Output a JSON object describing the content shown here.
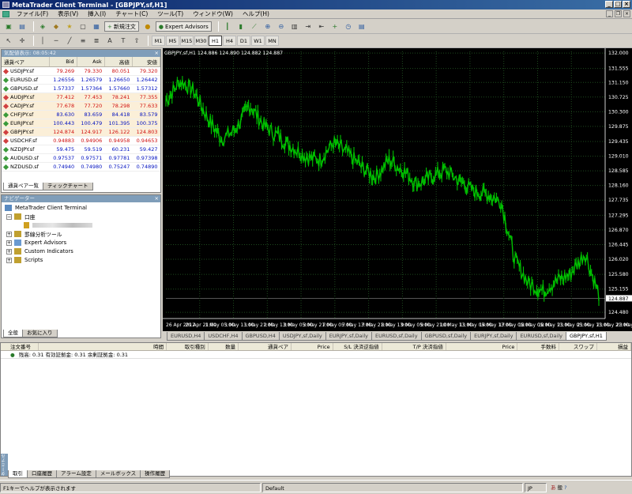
{
  "window": {
    "title": "MetaTrader Client Terminal - [GBPJPY,sf,H1]"
  },
  "menu": [
    "ファイル(F)",
    "表示(V)",
    "挿入(I)",
    "チャート(C)",
    "ツール(T)",
    "ウィンドウ(W)",
    "ヘルプ(H)"
  ],
  "toolbar": {
    "new_order": "新規注文",
    "expert_advisors": "Expert Advisors"
  },
  "timeframes": [
    "M1",
    "M5",
    "M15",
    "M30",
    "H1",
    "H4",
    "D1",
    "W1",
    "MN"
  ],
  "timeframe_active": "H1",
  "market_watch": {
    "title": "気配値表示: 08:05:42",
    "columns": [
      "通貨ペア",
      "Bid",
      "Ask",
      "高値",
      "安値"
    ],
    "rows": [
      {
        "symbol": "USDJPY.sf",
        "bid": "79.269",
        "ask": "79.330",
        "high": "80.051",
        "low": "79.320",
        "dir": "down"
      },
      {
        "symbol": "EURUSD.sf",
        "bid": "1.26556",
        "ask": "1.26579",
        "high": "1.26650",
        "low": "1.26442",
        "dir": "up"
      },
      {
        "symbol": "GBPUSD.sf",
        "bid": "1.57337",
        "ask": "1.57364",
        "high": "1.57660",
        "low": "1.57312",
        "dir": "up"
      },
      {
        "symbol": "AUDJPY.sf",
        "bid": "77.412",
        "ask": "77.453",
        "high": "78.241",
        "low": "77.355",
        "dir": "down"
      },
      {
        "symbol": "CADJPY.sf",
        "bid": "77.678",
        "ask": "77.720",
        "high": "78.298",
        "low": "77.633",
        "dir": "down"
      },
      {
        "symbol": "CHFJPY.sf",
        "bid": "83.630",
        "ask": "83.659",
        "high": "84.418",
        "low": "83.579",
        "dir": "up"
      },
      {
        "symbol": "EURJPY.sf",
        "bid": "100.443",
        "ask": "100.479",
        "high": "101.395",
        "low": "100.375",
        "dir": "up"
      },
      {
        "symbol": "GBPJPY.sf",
        "bid": "124.874",
        "ask": "124.917",
        "high": "126.122",
        "low": "124.803",
        "dir": "down"
      },
      {
        "symbol": "USDCHF.sf",
        "bid": "0.94883",
        "ask": "0.94906",
        "high": "0.94958",
        "low": "0.94653",
        "dir": "down"
      },
      {
        "symbol": "NZDJPY.sf",
        "bid": "59.475",
        "ask": "59.519",
        "high": "60.231",
        "low": "59.427",
        "dir": "up"
      },
      {
        "symbol": "AUDUSD.sf",
        "bid": "0.97537",
        "ask": "0.97571",
        "high": "0.97781",
        "low": "0.97398",
        "dir": "up"
      },
      {
        "symbol": "NZDUSD.sf",
        "bid": "0.74940",
        "ask": "0.74980",
        "high": "0.75247",
        "low": "0.74890",
        "dir": "up"
      }
    ],
    "tabs": [
      "通貨ペア一覧",
      "ティックチャート"
    ]
  },
  "navigator": {
    "title": "ナビゲーター",
    "root": "MetaTrader Client Terminal",
    "account_folder": "口座",
    "items": [
      "罫線分析ツール",
      "Expert Advisors",
      "Custom Indicators",
      "Scripts"
    ],
    "tabs": [
      "全般",
      "お気に入り"
    ]
  },
  "chart": {
    "header": "GBPJPY,sf,H1  124.886 124.890 124.882 124.887",
    "current_price": "124.887",
    "colors": {
      "background": "#000000",
      "candle": "#00c000",
      "grid": "#1e4a1e",
      "axis": "#ffffff"
    }
  },
  "chart_data": {
    "type": "line",
    "title": "GBPJPY,sf,H1",
    "x": [
      "26 Apr 2012",
      "29 Apr 21:00",
      "1 May 05:00",
      "1 May 13:00",
      "1 May 21:00",
      "2 May 05:00",
      "2 May 13:00",
      "3 May 05:00",
      "3 May 21:00",
      "4 May 05:00",
      "4 May 13:00",
      "7 May 05:00",
      "7 May 21:00",
      "8 May 13:00",
      "9 May 05:00",
      "9 May 21:00",
      "10 May 13:00",
      "11 May 05:00",
      "11 May 21:00",
      "14 May 13:00",
      "15 May 05:00",
      "15 May 13:00",
      "15 May 21:00",
      "16 May 13:00",
      "17 May 05:00",
      "17 May 13:00",
      "18 May 05:00",
      "18 May 13:00",
      "21 May 05:00",
      "21 May 21:00",
      "22 May 13:00",
      "23 May 05:00"
    ],
    "series": [
      {
        "values": [
          130.6,
          131.2,
          130.9,
          130.1,
          129.5,
          129.8,
          130.5,
          129.9,
          129.6,
          129.3,
          129.0,
          128.9,
          129.4,
          129.1,
          128.7,
          128.4,
          128.9,
          128.6,
          128.2,
          128.4,
          128.6,
          128.3,
          128.0,
          127.9,
          127.7,
          126.0,
          125.3,
          125.1,
          125.4,
          125.6,
          126.2,
          125.0
        ]
      }
    ],
    "yticks": [
      "132.000",
      "131.555",
      "131.150",
      "130.725",
      "130.300",
      "129.875",
      "129.435",
      "129.010",
      "128.585",
      "128.160",
      "127.735",
      "127.295",
      "126.870",
      "126.445",
      "126.020",
      "125.580",
      "125.155",
      "124.887",
      "124.480"
    ],
    "xticks": [
      "26 Apr 2012",
      "29 Apr 21:00",
      "1 May 05:00",
      "1 May 13:00",
      "1 May 21:00",
      "2 May 13:00",
      "3 May 05:00",
      "3 May 21:00",
      "7 May 05:00",
      "7 May 13:00",
      "7 May 21:00",
      "8 May 13:00",
      "9 May 05:00",
      "9 May 21:00",
      "10 May 13:00",
      "11 May 05:00",
      "14 May 13:00",
      "17 May 05:00",
      "18 May 05:00",
      "18 May 13:00",
      "21 May 05:00",
      "21 May 13:00",
      "21 May 21:00",
      "23 May 08:00"
    ],
    "ylim": [
      124.3,
      132.05
    ]
  },
  "chart_tabs": [
    "EURUSD,H4",
    "USDCHF,H4",
    "GBPUSD,H4",
    "USDJPY,sf,Daily",
    "EURJPY,sf,Daily",
    "EURUSD,sf,Daily",
    "GBPUSD,sf,Daily",
    "EURJPY,sf,Daily",
    "EURUSD,sf,Daily",
    "GBPJPY,sf,H1"
  ],
  "terminal": {
    "columns": [
      "注文番号",
      "時間",
      "取引種別",
      "数量",
      "通貨ペア",
      "Price",
      "S/L 決済逆指値",
      "T/P 決済指値",
      "Price",
      "手数料",
      "スワップ",
      "損益"
    ],
    "balance": "残高: 0.31  有効証拠金: 0.31  余剰証拠金: 0.31",
    "tabs": [
      "取引",
      "口座履歴",
      "アラーム設定",
      "メールボックス",
      "操作履歴"
    ],
    "side_label": "ターミナル"
  },
  "statusbar": {
    "help": "F1キーでヘルプが表示されます",
    "profile": "Default",
    "lang": "JP"
  }
}
